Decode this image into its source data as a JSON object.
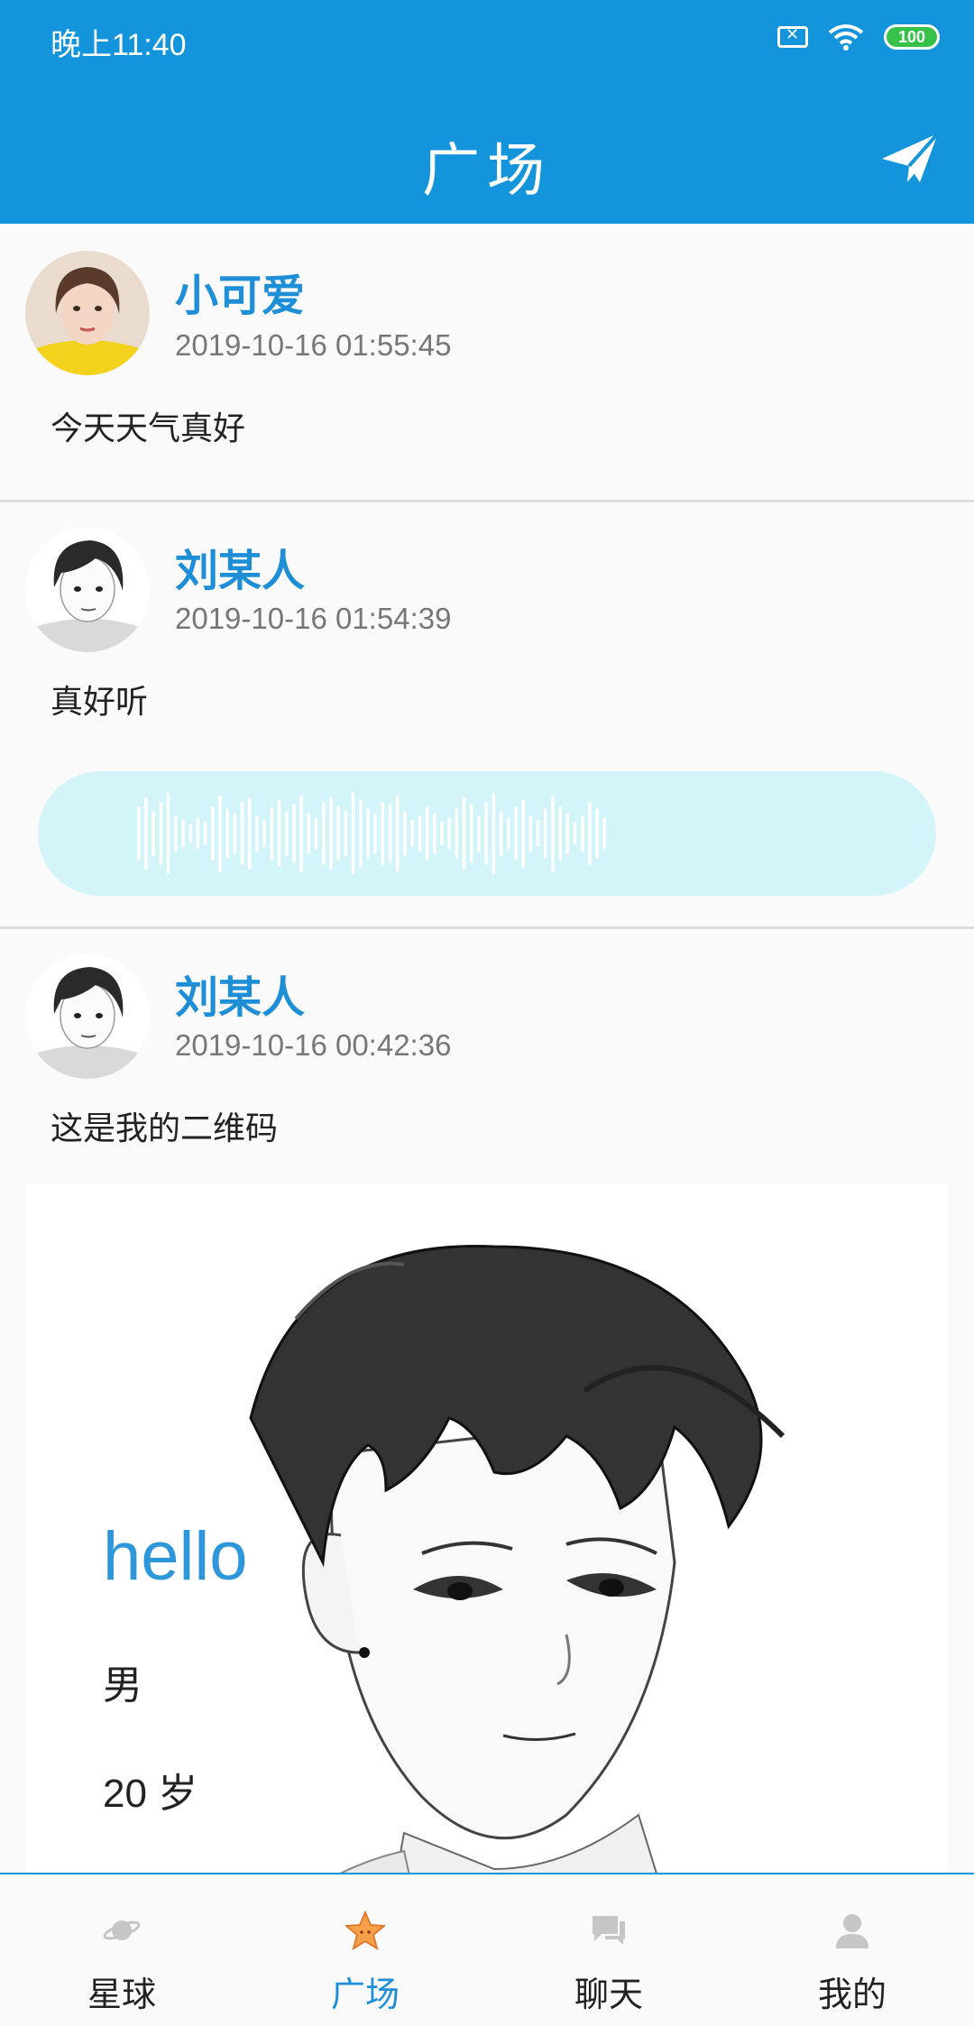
{
  "status_bar": {
    "time": "晚上11:40",
    "battery": "100"
  },
  "header": {
    "title": "广场"
  },
  "posts": [
    {
      "author": "小可爱",
      "timestamp": "2019-10-16 01:55:45",
      "text": "今天天气真好"
    },
    {
      "author": "刘某人",
      "timestamp": "2019-10-16 01:54:39",
      "text": "真好听"
    },
    {
      "author": "刘某人",
      "timestamp": "2019-10-16 00:42:36",
      "text": "这是我的二维码",
      "card": {
        "greeting": "hello",
        "gender": "男",
        "age": "20 岁"
      }
    }
  ],
  "tabs": [
    {
      "label": "星球",
      "icon": "planet-icon",
      "active": false
    },
    {
      "label": "广场",
      "icon": "star-icon",
      "active": true
    },
    {
      "label": "聊天",
      "icon": "chat-icon",
      "active": false
    },
    {
      "label": "我的",
      "icon": "user-icon",
      "active": false
    }
  ],
  "colors": {
    "primary": "#1394db",
    "name": "#1e8fd6",
    "voice_bg": "#d3f5f9",
    "active_star": "#f7a04b"
  }
}
